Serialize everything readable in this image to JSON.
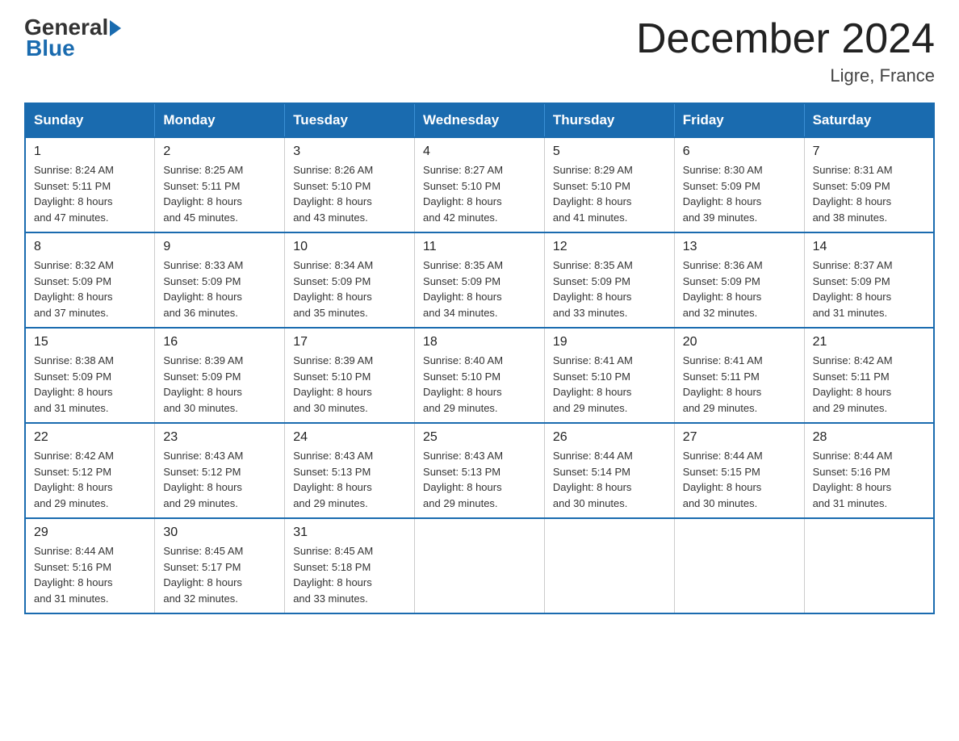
{
  "header": {
    "logo_general": "General",
    "logo_blue": "Blue",
    "month_title": "December 2024",
    "location": "Ligre, France"
  },
  "days_of_week": [
    "Sunday",
    "Monday",
    "Tuesday",
    "Wednesday",
    "Thursday",
    "Friday",
    "Saturday"
  ],
  "weeks": [
    [
      {
        "day": "1",
        "sunrise": "8:24 AM",
        "sunset": "5:11 PM",
        "daylight": "8 hours and 47 minutes."
      },
      {
        "day": "2",
        "sunrise": "8:25 AM",
        "sunset": "5:11 PM",
        "daylight": "8 hours and 45 minutes."
      },
      {
        "day": "3",
        "sunrise": "8:26 AM",
        "sunset": "5:10 PM",
        "daylight": "8 hours and 43 minutes."
      },
      {
        "day": "4",
        "sunrise": "8:27 AM",
        "sunset": "5:10 PM",
        "daylight": "8 hours and 42 minutes."
      },
      {
        "day": "5",
        "sunrise": "8:29 AM",
        "sunset": "5:10 PM",
        "daylight": "8 hours and 41 minutes."
      },
      {
        "day": "6",
        "sunrise": "8:30 AM",
        "sunset": "5:09 PM",
        "daylight": "8 hours and 39 minutes."
      },
      {
        "day": "7",
        "sunrise": "8:31 AM",
        "sunset": "5:09 PM",
        "daylight": "8 hours and 38 minutes."
      }
    ],
    [
      {
        "day": "8",
        "sunrise": "8:32 AM",
        "sunset": "5:09 PM",
        "daylight": "8 hours and 37 minutes."
      },
      {
        "day": "9",
        "sunrise": "8:33 AM",
        "sunset": "5:09 PM",
        "daylight": "8 hours and 36 minutes."
      },
      {
        "day": "10",
        "sunrise": "8:34 AM",
        "sunset": "5:09 PM",
        "daylight": "8 hours and 35 minutes."
      },
      {
        "day": "11",
        "sunrise": "8:35 AM",
        "sunset": "5:09 PM",
        "daylight": "8 hours and 34 minutes."
      },
      {
        "day": "12",
        "sunrise": "8:35 AM",
        "sunset": "5:09 PM",
        "daylight": "8 hours and 33 minutes."
      },
      {
        "day": "13",
        "sunrise": "8:36 AM",
        "sunset": "5:09 PM",
        "daylight": "8 hours and 32 minutes."
      },
      {
        "day": "14",
        "sunrise": "8:37 AM",
        "sunset": "5:09 PM",
        "daylight": "8 hours and 31 minutes."
      }
    ],
    [
      {
        "day": "15",
        "sunrise": "8:38 AM",
        "sunset": "5:09 PM",
        "daylight": "8 hours and 31 minutes."
      },
      {
        "day": "16",
        "sunrise": "8:39 AM",
        "sunset": "5:09 PM",
        "daylight": "8 hours and 30 minutes."
      },
      {
        "day": "17",
        "sunrise": "8:39 AM",
        "sunset": "5:10 PM",
        "daylight": "8 hours and 30 minutes."
      },
      {
        "day": "18",
        "sunrise": "8:40 AM",
        "sunset": "5:10 PM",
        "daylight": "8 hours and 29 minutes."
      },
      {
        "day": "19",
        "sunrise": "8:41 AM",
        "sunset": "5:10 PM",
        "daylight": "8 hours and 29 minutes."
      },
      {
        "day": "20",
        "sunrise": "8:41 AM",
        "sunset": "5:11 PM",
        "daylight": "8 hours and 29 minutes."
      },
      {
        "day": "21",
        "sunrise": "8:42 AM",
        "sunset": "5:11 PM",
        "daylight": "8 hours and 29 minutes."
      }
    ],
    [
      {
        "day": "22",
        "sunrise": "8:42 AM",
        "sunset": "5:12 PM",
        "daylight": "8 hours and 29 minutes."
      },
      {
        "day": "23",
        "sunrise": "8:43 AM",
        "sunset": "5:12 PM",
        "daylight": "8 hours and 29 minutes."
      },
      {
        "day": "24",
        "sunrise": "8:43 AM",
        "sunset": "5:13 PM",
        "daylight": "8 hours and 29 minutes."
      },
      {
        "day": "25",
        "sunrise": "8:43 AM",
        "sunset": "5:13 PM",
        "daylight": "8 hours and 29 minutes."
      },
      {
        "day": "26",
        "sunrise": "8:44 AM",
        "sunset": "5:14 PM",
        "daylight": "8 hours and 30 minutes."
      },
      {
        "day": "27",
        "sunrise": "8:44 AM",
        "sunset": "5:15 PM",
        "daylight": "8 hours and 30 minutes."
      },
      {
        "day": "28",
        "sunrise": "8:44 AM",
        "sunset": "5:16 PM",
        "daylight": "8 hours and 31 minutes."
      }
    ],
    [
      {
        "day": "29",
        "sunrise": "8:44 AM",
        "sunset": "5:16 PM",
        "daylight": "8 hours and 31 minutes."
      },
      {
        "day": "30",
        "sunrise": "8:45 AM",
        "sunset": "5:17 PM",
        "daylight": "8 hours and 32 minutes."
      },
      {
        "day": "31",
        "sunrise": "8:45 AM",
        "sunset": "5:18 PM",
        "daylight": "8 hours and 33 minutes."
      },
      null,
      null,
      null,
      null
    ]
  ]
}
